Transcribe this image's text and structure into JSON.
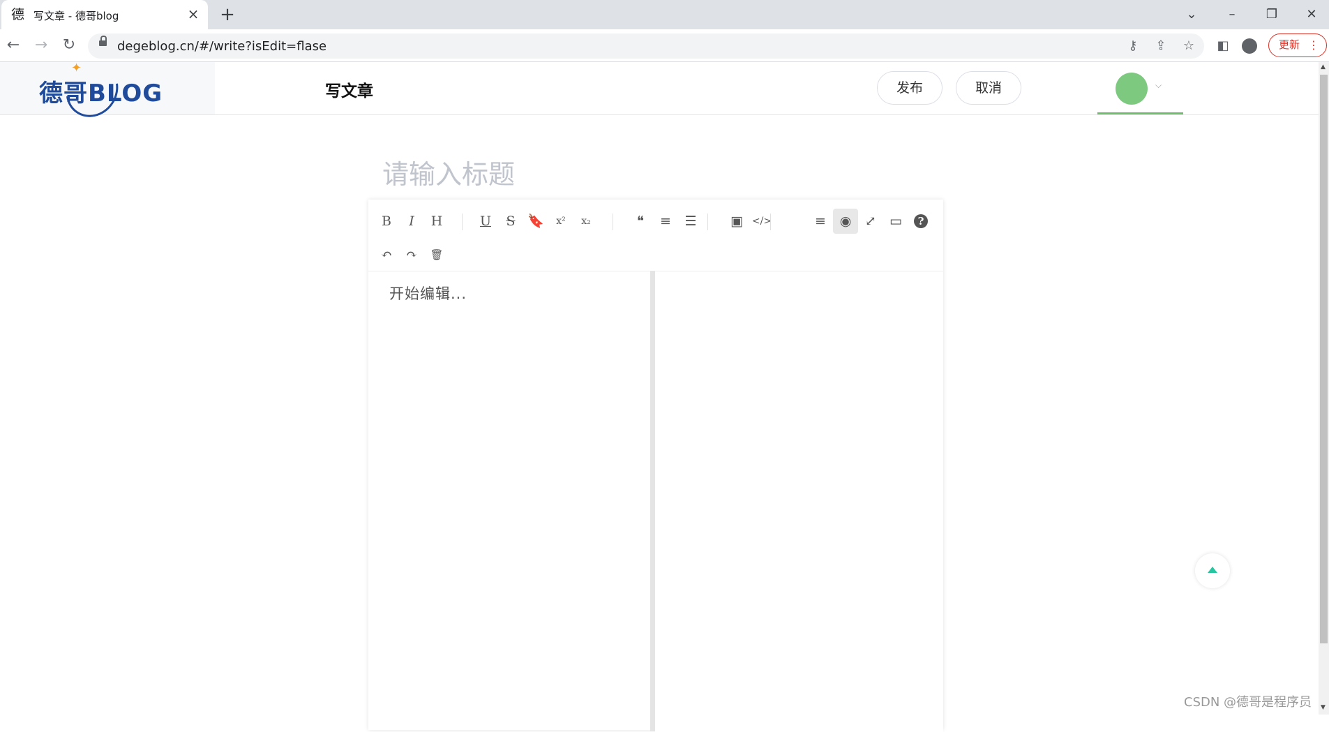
{
  "browser": {
    "tab_title": "写文章 - 德哥blog",
    "tab_favicon": "德",
    "url": "degeblog.cn/#/write?isEdit=flase",
    "update_label": "更新"
  },
  "header": {
    "logo_text": "德哥BLOG",
    "page_heading": "写文章",
    "publish_label": "发布",
    "cancel_label": "取消"
  },
  "editor": {
    "title_placeholder": "请输入标题",
    "content_placeholder": "开始编辑...",
    "toolbar_row1": [
      {
        "name": "bold",
        "glyph": "B"
      },
      {
        "name": "italic",
        "glyph": "I"
      },
      {
        "name": "header",
        "glyph": "H"
      },
      {
        "name": "underline",
        "glyph": "U"
      },
      {
        "name": "strikethrough",
        "glyph": "S"
      },
      {
        "name": "mark",
        "glyph": "🔖"
      },
      {
        "name": "superscript",
        "glyph": "x²"
      },
      {
        "name": "subscript",
        "glyph": "x₂"
      },
      {
        "name": "quote",
        "glyph": "❝"
      },
      {
        "name": "ordered-list",
        "glyph": "≡"
      },
      {
        "name": "unordered-list",
        "glyph": "☰"
      },
      {
        "name": "image",
        "glyph": "▣"
      },
      {
        "name": "code",
        "glyph": "</>"
      },
      {
        "name": "navigation",
        "glyph": "≡"
      },
      {
        "name": "preview-toggle",
        "glyph": "◉"
      },
      {
        "name": "fullscreen",
        "glyph": "⤢"
      },
      {
        "name": "read-mode",
        "glyph": "▭"
      },
      {
        "name": "help",
        "glyph": "?"
      }
    ],
    "toolbar_row2": [
      {
        "name": "undo",
        "glyph": "↶"
      },
      {
        "name": "redo",
        "glyph": "↷"
      },
      {
        "name": "trash",
        "glyph": "🗑"
      }
    ]
  },
  "watermark": "CSDN @德哥是程序员"
}
